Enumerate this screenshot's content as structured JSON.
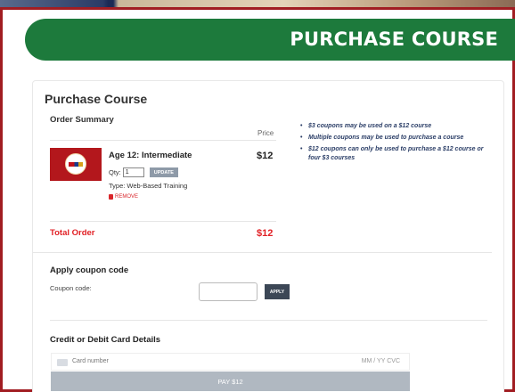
{
  "banner": {
    "title": "PURCHASE COURSE"
  },
  "card": {
    "title": "Purchase Course"
  },
  "order": {
    "heading": "Order Summary",
    "price_header": "Price",
    "item": {
      "name": "Age 12: Intermediate",
      "qty_label": "Qty:",
      "qty_value": "1",
      "update_label": "UPDATE",
      "type_text": "Type: Web-Based Training",
      "remove_label": "REMOVE",
      "price": "$12"
    },
    "total_label": "Total Order",
    "total_value": "$12"
  },
  "notes": [
    "$3 coupons may be used on a $12 course",
    "Multiple coupons may be used to purchase a course",
    "$12 coupons can only be used to purchase a $12 course or four $3 courses"
  ],
  "coupon": {
    "title": "Apply coupon code",
    "label": "Coupon code:",
    "value": "",
    "apply_label": "APPLY"
  },
  "payment": {
    "title": "Credit or Debit Card Details",
    "card_number_placeholder": "Card number",
    "exp_cvc": "MM / YY  CVC",
    "pay_label": "PAY $12"
  },
  "colors": {
    "banner": "#1d7a3c",
    "frame": "#a11d22",
    "total": "#e11f24",
    "notes": "#2a3d66"
  },
  "icons": {
    "card": "credit-card-icon",
    "remove": "trash-icon"
  }
}
